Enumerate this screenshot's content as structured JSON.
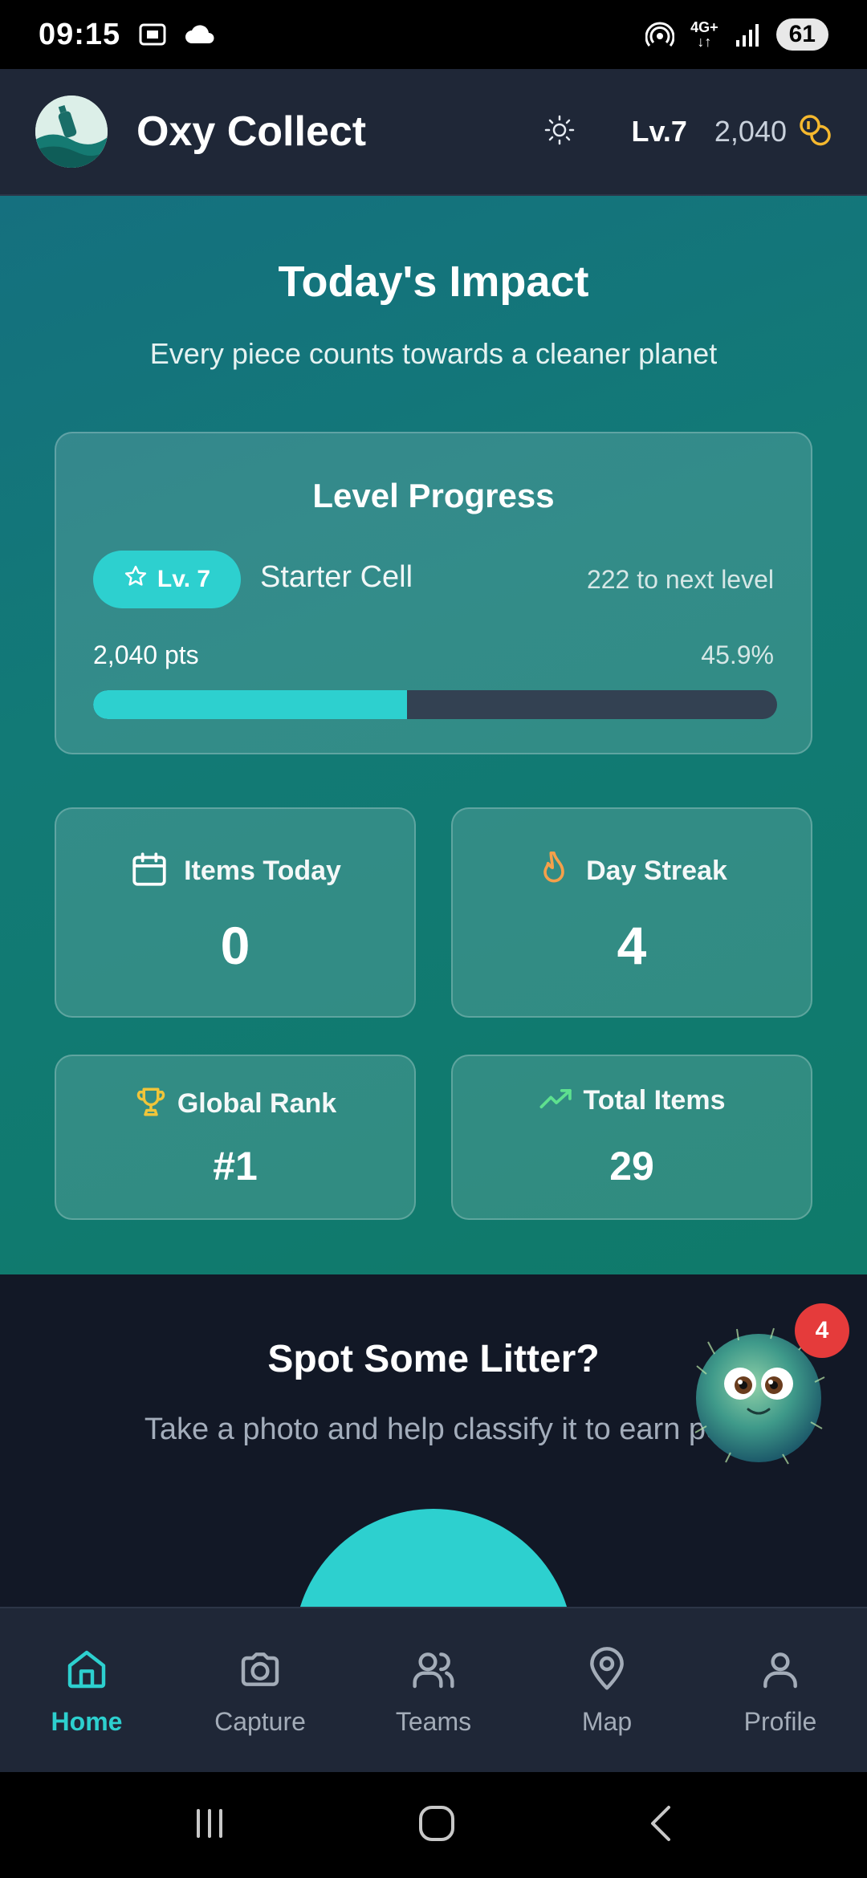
{
  "status_bar": {
    "time": "09:15",
    "network": "4G+",
    "battery": "61",
    "icons": [
      "screenshot-icon",
      "cloud-icon",
      "hotspot-icon",
      "network-icon",
      "signal-icon"
    ]
  },
  "header": {
    "app_title": "Oxy Collect",
    "level": "Lv.7",
    "coins": "2,040",
    "icons": [
      "app-logo",
      "sun-icon",
      "coins-icon"
    ]
  },
  "hero": {
    "title": "Today's Impact",
    "subtitle": "Every piece counts towards a cleaner planet",
    "level_card": {
      "title": "Level Progress",
      "badge": "Lv. 7",
      "tier": "Starter Cell",
      "next_level": "222 to next level",
      "points": "2,040 pts",
      "percent_label": "45.9%",
      "progress": 0.459
    },
    "stats": [
      {
        "label": "Items Today",
        "value": "0",
        "icon": "calendar-icon"
      },
      {
        "label": "Day Streak",
        "value": "4",
        "icon": "flame-icon"
      },
      {
        "label": "Global Rank",
        "value": "#1",
        "icon": "trophy-icon"
      },
      {
        "label": "Total Items",
        "value": "29",
        "icon": "trending-up-icon"
      }
    ]
  },
  "spot": {
    "title": "Spot Some Litter?",
    "subtitle": "Take a photo and help classify it to earn po",
    "mascot_badge": "4"
  },
  "nav": [
    {
      "label": "Home",
      "icon": "home-icon",
      "active": true
    },
    {
      "label": "Capture",
      "icon": "camera-icon",
      "active": false
    },
    {
      "label": "Teams",
      "icon": "users-icon",
      "active": false
    },
    {
      "label": "Map",
      "icon": "map-pin-icon",
      "active": false
    },
    {
      "label": "Profile",
      "icon": "user-icon",
      "active": false
    }
  ],
  "colors": {
    "accent": "#2dd0cf",
    "header_bg": "#1f2737",
    "page_bg": "#121826",
    "badge_red": "#e53b3b"
  }
}
